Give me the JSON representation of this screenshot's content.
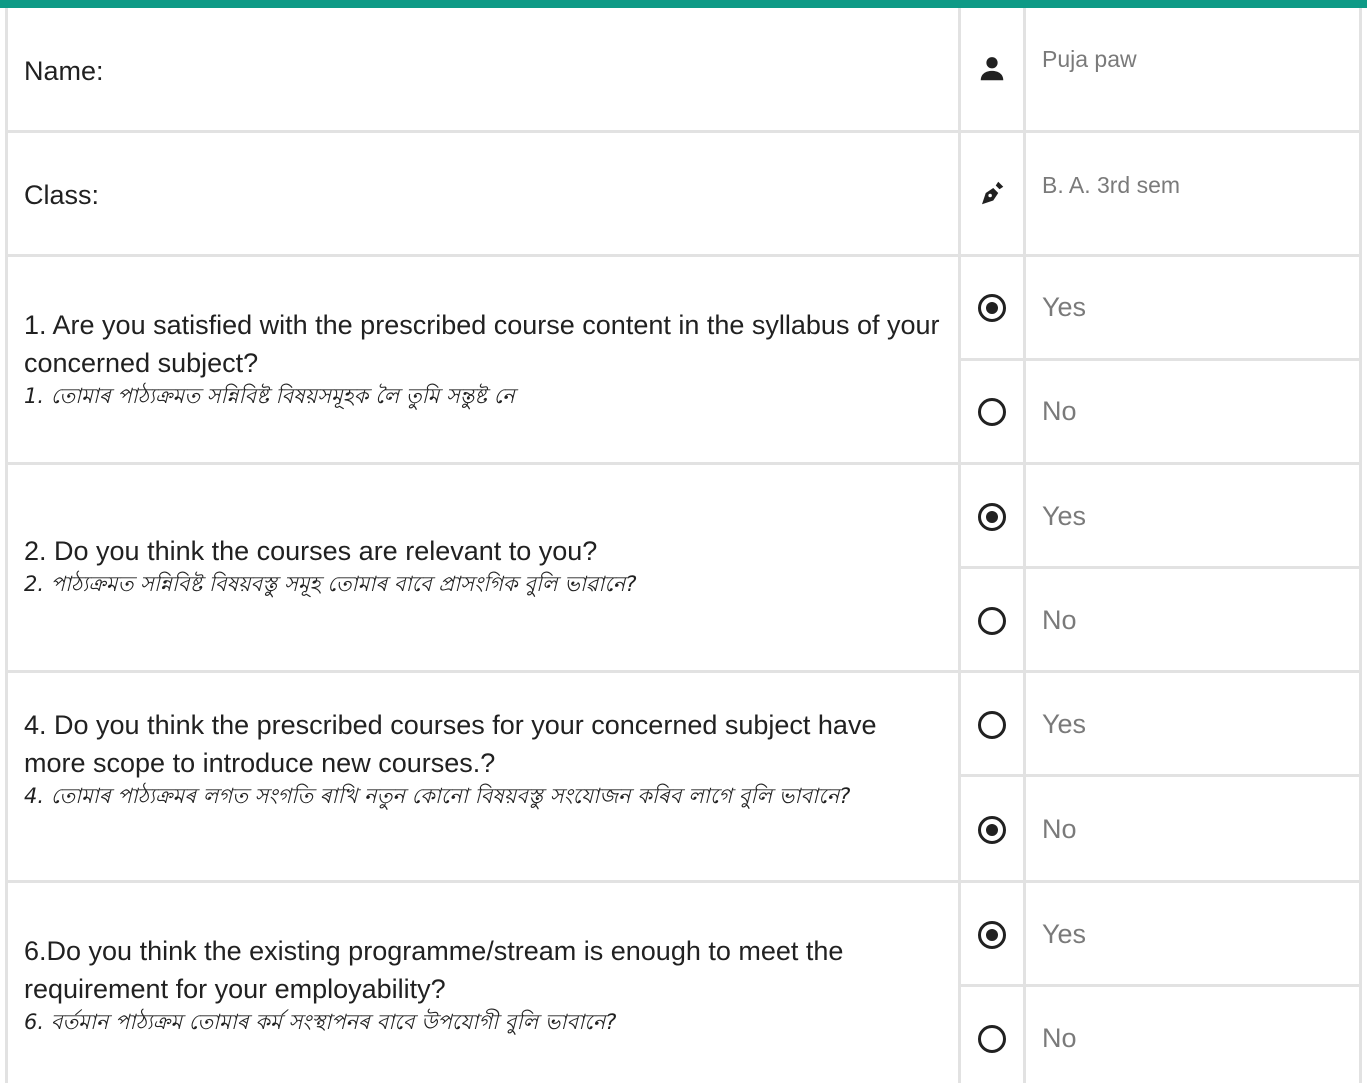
{
  "profile": {
    "name_label": "Name:",
    "name_value": "Puja paw",
    "name_icon": "person-icon",
    "class_label": "Class:",
    "class_value": "B. A. 3rd sem",
    "class_icon": "pen-nib-icon"
  },
  "questions": [
    {
      "en": "1. Are you satisfied with the prescribed course content in the syllabus of your concerned subject?",
      "as": "1. তোমাৰ পাঠ্যক্ৰমত সন্নিবিষ্ট বিষয়সমূহক লৈ তুমি সন্তুষ্ট নে",
      "options": [
        "Yes",
        "No"
      ],
      "selected": "Yes"
    },
    {
      "en": "2. Do you think the courses are relevant to you?",
      "as": "2. পাঠ্যক্ৰমত সন্নিবিষ্ট বিষয়বস্তু সমূহ তোমাৰ বাবে প্ৰাসংগিক বুলি ভাৱানে?",
      "options": [
        "Yes",
        "No"
      ],
      "selected": "Yes"
    },
    {
      "en": "4. Do you think the prescribed courses for your concerned subject have more scope to introduce new courses.?",
      "as": "4. তোমাৰ পাঠ্যক্ৰমৰ লগত সংগতি ৰাখি নতুন কোনো বিষয়বস্তু সংযোজন কৰিব লাগে বুলি ভাবানে?",
      "options": [
        "Yes",
        "No"
      ],
      "selected": "No"
    },
    {
      "en": "6.Do you think the existing programme/stream is enough to meet the requirement for your employability?",
      "as": "6. বৰ্তমান পাঠ্যক্ৰম তোমাৰ কৰ্ম সংস্থাপনৰ বাবে উপযোগী বুলি ভাবানে?",
      "options": [
        "Yes",
        "No"
      ],
      "selected": "Yes"
    }
  ],
  "colors": {
    "accent": "#0e9a86",
    "grid": "#e2e2e2",
    "value_text": "#7a7a7a"
  }
}
